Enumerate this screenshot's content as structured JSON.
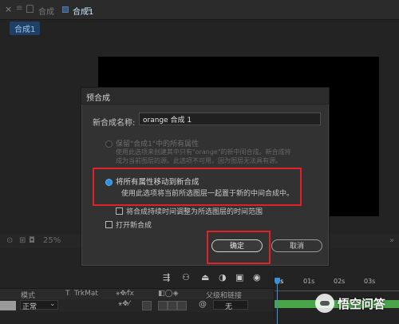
{
  "topbar": {
    "close_glyph": "×",
    "menu_glyph": "≡",
    "prefix_label": "合成",
    "sep_glyph": "|",
    "active_comp": "合成1",
    "hamburger_glyph": "≡"
  },
  "comp_tab": {
    "label": "合成1"
  },
  "viewer_toolbar": {
    "zoom": "25%"
  },
  "dialog": {
    "title": "预合成",
    "name_label": "新合成名称:",
    "name_value": "orange 合成 1",
    "option1": {
      "label": "保留\"合成1\"中的所有属性",
      "desc_line1": "使用此选项来创建其中只有\"orange\"的新中间合成。新合成将",
      "desc_line2": "成为当前图层的源。此选项不可用，因为图层无法具有源。"
    },
    "option2": {
      "label": "将所有属性移动到新合成",
      "desc": "使用此选项将当前所选图层一起置于新的中间合成中。"
    },
    "checkbox_adjust": {
      "label": "将合成持续时间调整为所选图层的时间范围"
    },
    "checkbox_open": {
      "label": "打开新合成"
    },
    "ok_label": "确定",
    "cancel_label": "取消"
  },
  "timeline": {
    "col_mode": "模式",
    "col_t": "T",
    "col_trkmat": "TrkMat",
    "col_parent": "父级和链接",
    "mode_value": "正常",
    "parent_value": "无",
    "ruler_ticks": [
      "01s",
      "02s",
      "03s"
    ],
    "playhead_label": "0s"
  },
  "watermark": {
    "text": "悟空问答"
  },
  "colors": {
    "accent": "#2f8fe0",
    "highlight": "#e2202a",
    "workarea": "#4aa54a"
  }
}
